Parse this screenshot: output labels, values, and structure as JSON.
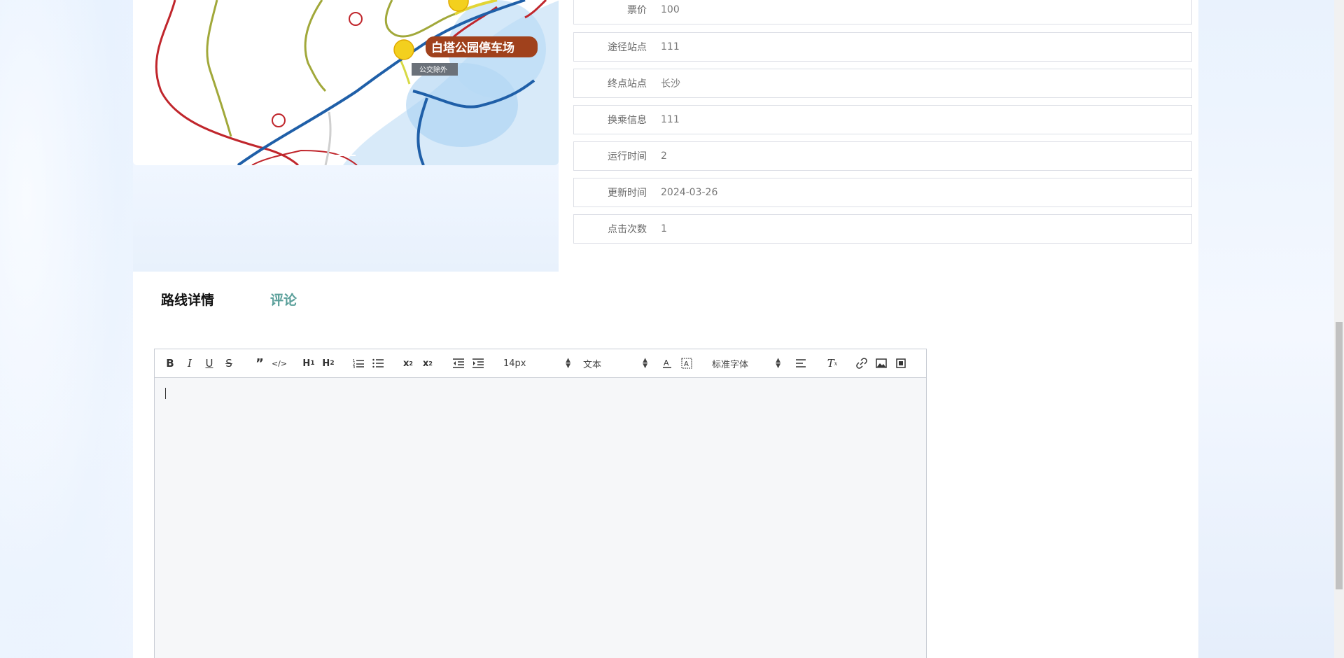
{
  "map": {
    "label_parking": "白塔公园停车场",
    "label_bus": "公交除外"
  },
  "info": {
    "rows": [
      {
        "label": "票价",
        "value": "100"
      },
      {
        "label": "途径站点",
        "value": "111"
      },
      {
        "label": "终点站点",
        "value": "长沙"
      },
      {
        "label": "换乘信息",
        "value": "111"
      },
      {
        "label": "运行时间",
        "value": "2"
      },
      {
        "label": "更新时间",
        "value": "2024-03-26"
      },
      {
        "label": "点击次数",
        "value": "1"
      }
    ]
  },
  "tabs": {
    "detail": "路线详情",
    "comment": "评论"
  },
  "editor": {
    "font_size": "14px",
    "header_type": "文本",
    "font_family": "标准字体"
  },
  "colors": {
    "tab_active": "#111111",
    "tab_inactive": "#5a9f9a",
    "parking_label_bg": "#a0411c"
  }
}
